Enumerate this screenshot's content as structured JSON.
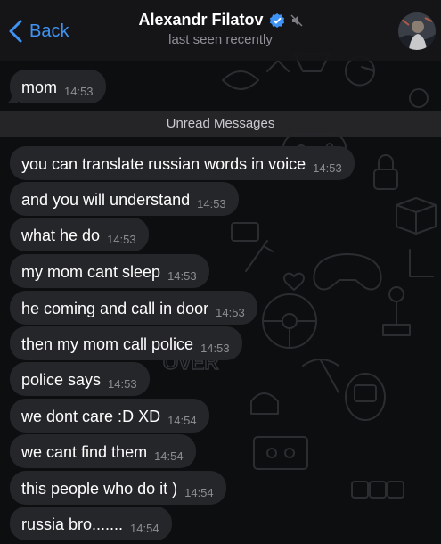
{
  "header": {
    "back_label": "Back",
    "contact_name": "Alexandr Filatov",
    "status": "last seen recently",
    "accent_color": "#3e93f5"
  },
  "unread_banner": "Unread Messages",
  "wallpaper_text": "OVER",
  "messages_before": [
    {
      "text": "mom",
      "time": "14:53"
    }
  ],
  "messages_after": [
    {
      "text": "you can translate russian words in voice",
      "time": "14:53"
    },
    {
      "text": "and  you will understand",
      "time": "14:53"
    },
    {
      "text": "what he do",
      "time": "14:53"
    },
    {
      "text": "my mom cant sleep",
      "time": "14:53"
    },
    {
      "text": "he coming and call in door",
      "time": "14:53"
    },
    {
      "text": "then my mom call police",
      "time": "14:53"
    },
    {
      "text": "police says",
      "time": "14:53"
    },
    {
      "text": "we dont care :D XD",
      "time": "14:54"
    },
    {
      "text": "we cant find them",
      "time": "14:54"
    },
    {
      "text": "this people who do it )",
      "time": "14:54"
    },
    {
      "text": "russia bro.......",
      "time": "14:54"
    }
  ]
}
